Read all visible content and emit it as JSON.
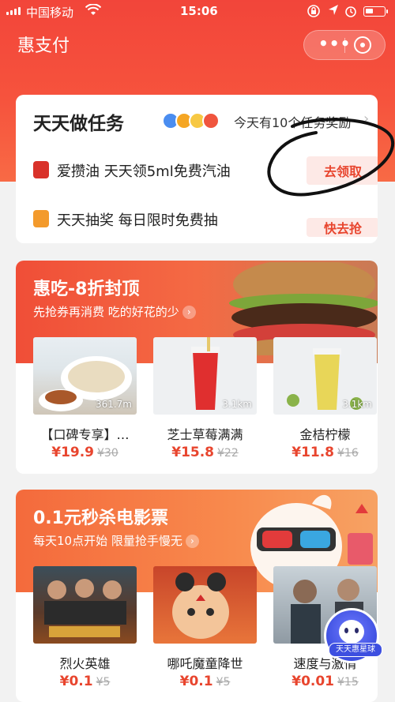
{
  "status_bar": {
    "carrier": "中国移动",
    "time": "15:06",
    "wifi_icon": "wifi-icon",
    "battery_icon": "battery-icon"
  },
  "header": {
    "title": "惠支付",
    "more_label": "•••"
  },
  "tasks": {
    "title": "天天做任务",
    "summary": "今天有10个任务奖励",
    "items": [
      {
        "label": "爱攒油 天天领5ml免费汽油",
        "button": "去领取"
      },
      {
        "label": "天天抽奖 每日限时免费抽",
        "button": "快去抢"
      }
    ]
  },
  "food": {
    "title": "惠吃-8折封顶",
    "subtitle": "先抢券再消费 吃的好花的少",
    "items": [
      {
        "name": "【口碑专享】…",
        "price": "¥19.9",
        "old_price": "¥30",
        "distance": "361.7m"
      },
      {
        "name": "芝士草莓满满",
        "price": "¥15.8",
        "old_price": "¥22",
        "distance": "3.1km"
      },
      {
        "name": "金桔柠檬",
        "price": "¥11.8",
        "old_price": "¥16",
        "distance": "3.1km"
      }
    ]
  },
  "movies": {
    "title": "0.1元秒杀电影票",
    "subtitle": "每天10点开始 限量抢手慢无",
    "items": [
      {
        "name": "烈火英雄",
        "price": "¥0.1",
        "old_price": "¥5"
      },
      {
        "name": "哪吒魔童降世",
        "price": "¥0.1",
        "old_price": "¥5"
      },
      {
        "name": "速度与激情",
        "price": "¥0.01",
        "old_price": "¥15"
      }
    ]
  },
  "floating_button": {
    "label": "天天惠星球"
  },
  "colors": {
    "brand_red": "#f2453a",
    "price_red": "#e8452e"
  }
}
